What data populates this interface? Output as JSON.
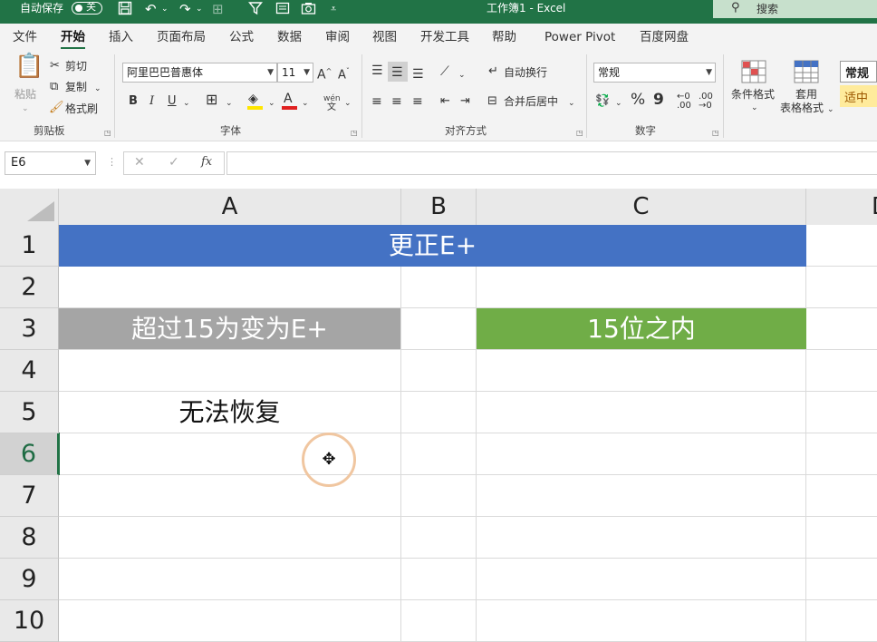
{
  "titlebar": {
    "autosave_label": "自动保存",
    "autosave_state": "关",
    "window_title": "工作簿1  -  Excel",
    "search_label": "搜索",
    "save_icon": "save-icon",
    "undo_icon": "undo-icon",
    "redo_icon": "redo-icon",
    "filter_icon": "filter-icon",
    "form_icon": "form-icon",
    "camera_icon": "camera-icon"
  },
  "tabs": [
    "文件",
    "开始",
    "插入",
    "页面布局",
    "公式",
    "数据",
    "审阅",
    "视图",
    "开发工具",
    "帮助",
    "Power Pivot",
    "百度网盘"
  ],
  "active_tab": "开始",
  "ribbon": {
    "clipboard": {
      "paste": "粘贴",
      "cut": "剪切",
      "copy": "复制",
      "format_painter": "格式刷",
      "group": "剪贴板"
    },
    "font": {
      "name": "阿里巴巴普惠体",
      "size": "11",
      "grow": "A^",
      "shrink": "Aˇ",
      "bold": "B",
      "italic": "I",
      "underline": "U",
      "phonetic": "wén",
      "group": "字体"
    },
    "alignment": {
      "wrap_text": "自动换行",
      "merge_center": "合并后居中",
      "group": "对齐方式"
    },
    "number": {
      "format": "常规",
      "percent": "%",
      "comma": "9",
      "group": "数字"
    },
    "styles": {
      "conditional": "条件格式",
      "table_line1": "套用",
      "table_line2": "表格格式",
      "style_normal": "常规",
      "style_neutral": "适中"
    }
  },
  "formula_bar": {
    "name_box": "E6",
    "fx": "fx",
    "cancel": "✕",
    "enter": "✓",
    "formula": ""
  },
  "columns": [
    "A",
    "B",
    "C",
    "D"
  ],
  "rows": [
    "1",
    "2",
    "3",
    "4",
    "5",
    "6",
    "7",
    "8",
    "9",
    "10"
  ],
  "selected_row": "6",
  "cells": {
    "title": "更正E+",
    "a3": "超过15为变为E+",
    "c3": "15位之内",
    "a5": "无法恢复"
  },
  "colors": {
    "excel_green": "#217346",
    "title_fill": "#4472C4",
    "a3_fill": "#A5A5A5",
    "c3_fill": "#70AD47",
    "cursor_ring": "#F0C6A0"
  }
}
